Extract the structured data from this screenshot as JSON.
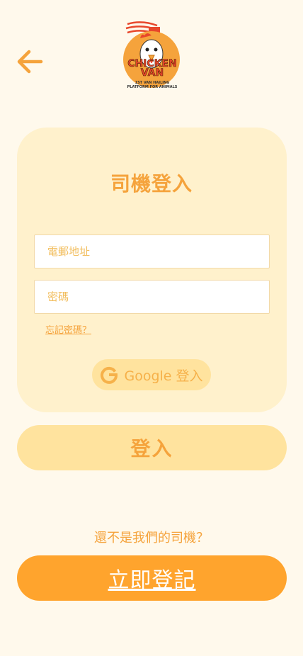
{
  "header": {
    "back_icon": "arrow-left-icon",
    "logo": {
      "brand_line1": "CHICKEN",
      "brand_line2": "VAN",
      "tagline_line1": "1ST VAN HAILING",
      "tagline_line2": "PLATFORM FOR ANIMALS"
    }
  },
  "login_card": {
    "title": "司機登入",
    "email_placeholder": "電郵地址",
    "password_placeholder": "密碼",
    "forgot_password": "忘記密碼？",
    "google_button": {
      "icon": "google-g-icon",
      "label": "Google 登入"
    }
  },
  "login_button": "登入",
  "register": {
    "prompt": "還不是我們的司機？",
    "button": "立即登記"
  },
  "colors": {
    "background": "#FFF9EC",
    "card": "#FFF1CC",
    "accent": "#F5A33C",
    "light_button": "#FFE39E",
    "primary_button": "#FFA42D"
  }
}
